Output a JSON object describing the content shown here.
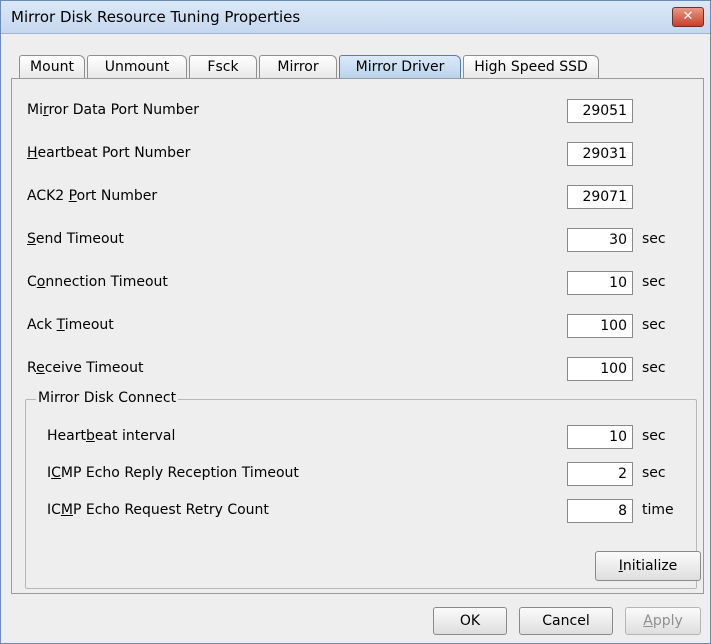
{
  "window": {
    "title": "Mirror Disk Resource Tuning Properties",
    "close_label": "✕"
  },
  "tabs": [
    {
      "label": "Mount"
    },
    {
      "label": "Unmount"
    },
    {
      "label": "Fsck"
    },
    {
      "label": "Mirror"
    },
    {
      "label": "Mirror Driver"
    },
    {
      "label": "High Speed SSD"
    }
  ],
  "fields": {
    "mirror_data_port": {
      "pre": "Mi",
      "key": "r",
      "post": "ror Data Port Number",
      "value": "29051",
      "unit": ""
    },
    "heartbeat_port": {
      "pre": "",
      "key": "H",
      "post": "eartbeat Port Number",
      "value": "29031",
      "unit": ""
    },
    "ack2_port": {
      "pre": "ACK2 ",
      "key": "P",
      "post": "ort Number",
      "value": "29071",
      "unit": ""
    },
    "send_timeout": {
      "pre": "",
      "key": "S",
      "post": "end Timeout",
      "value": "30",
      "unit": "sec"
    },
    "connection_timeout": {
      "pre": "C",
      "key": "o",
      "post": "nnection Timeout",
      "value": "10",
      "unit": "sec"
    },
    "ack_timeout": {
      "pre": "Ack ",
      "key": "T",
      "post": "imeout",
      "value": "100",
      "unit": "sec"
    },
    "receive_timeout": {
      "pre": "R",
      "key": "e",
      "post": "ceive Timeout",
      "value": "100",
      "unit": "sec"
    }
  },
  "group": {
    "title": "Mirror Disk Connect",
    "heartbeat_interval": {
      "pre": "Heart",
      "key": "b",
      "post": "eat interval",
      "value": "10",
      "unit": "sec"
    },
    "icmp_reply_timeout": {
      "pre": "I",
      "key": "C",
      "post": "MP Echo Reply Reception Timeout",
      "value": "2",
      "unit": "sec"
    },
    "icmp_retry_count": {
      "pre": "IC",
      "key": "M",
      "post": "P Echo Request Retry Count",
      "value": "8",
      "unit": "time"
    }
  },
  "buttons": {
    "initialize": {
      "key": "I",
      "post": "nitialize"
    },
    "ok": "OK",
    "cancel": "Cancel",
    "apply": {
      "key": "A",
      "post": "pply"
    }
  }
}
